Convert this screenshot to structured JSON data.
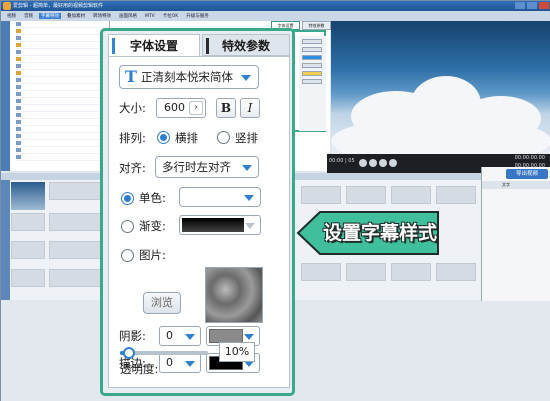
{
  "window": {
    "title": "爱剪辑 - 超简单，最好用的视频剪辑软件",
    "menu": [
      "视频",
      "音频",
      "字幕特效",
      "叠加素材",
      "转场特效",
      "画面风格",
      "MTV",
      "卡拉OK",
      "升级与服务"
    ],
    "active_menu_index": 2
  },
  "preview_tabs": [
    "字体设置",
    "特效参数"
  ],
  "player": {
    "frame_readout": "00:00 | 05",
    "time_current": "00:00:00.00",
    "time_total": "00:00:00.00"
  },
  "export_button": "导出视频",
  "right_panel_header": "文字",
  "callout": {
    "text": "设置字幕样式",
    "fill_color": "#3fbf9c"
  },
  "panel": {
    "tabs": [
      "字体设置",
      "特效参数"
    ],
    "active_tab": 0,
    "font_icon": "T",
    "font_name": "正清刻本悦宋简体",
    "size_label": "大小:",
    "size_value": "600",
    "size_arrow": "›",
    "bold_label": "B",
    "italic_label": "I",
    "arrange_label": "排列:",
    "arrange_options": [
      "横排",
      "竖排"
    ],
    "arrange_selected": 0,
    "align_label": "对齐:",
    "align_value": "多行时左对齐",
    "fill_options": [
      {
        "label": "单色:",
        "color": "#ffffff"
      },
      {
        "label": "渐变:",
        "color": "#1a1a1a"
      },
      {
        "label": "图片:"
      }
    ],
    "fill_selected": 0,
    "browse_label": "浏览",
    "shadow_label": "阴影:",
    "shadow_value": "0",
    "shadow_color": "#8a8a8a",
    "stroke_label": "描边:",
    "stroke_value": "0",
    "stroke_color": "#000000",
    "opacity_label": "透明度:",
    "opacity_value": "10%",
    "opacity_fraction": 0.1,
    "accent_color": "#2f7fd0",
    "border_color": "#3aa88a"
  }
}
